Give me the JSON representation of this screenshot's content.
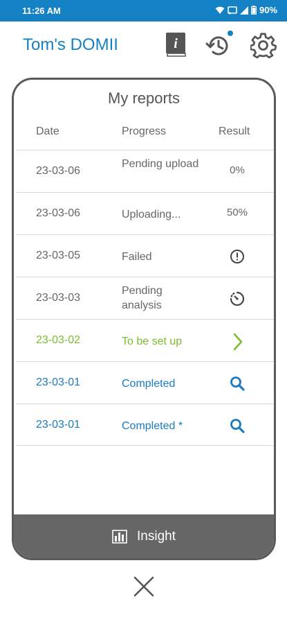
{
  "status_bar": {
    "time": "11:26 AM",
    "battery": "90%",
    "icons": [
      "wifi-icon",
      "cast-icon",
      "signal-icon",
      "battery-icon"
    ]
  },
  "header": {
    "title": "Tom's DOMII",
    "icons": [
      "info-book-icon",
      "history-icon",
      "settings-icon"
    ],
    "history_has_notification": true
  },
  "reports": {
    "title": "My reports",
    "columns": {
      "date": "Date",
      "progress": "Progress",
      "result": "Result"
    },
    "rows": [
      {
        "date": "23-03-06",
        "progress": "Pending upload",
        "result": "0%",
        "status": "pending"
      },
      {
        "date": "23-03-06",
        "progress": "Uploading...",
        "result": "50%",
        "status": "uploading"
      },
      {
        "date": "23-03-05",
        "progress": "Failed",
        "result_icon": "alert-circle-icon",
        "status": "failed"
      },
      {
        "date": "23-03-03",
        "progress": "Pending analysis",
        "result_icon": "timer-icon",
        "status": "analysis"
      },
      {
        "date": "23-03-02",
        "progress": "To be set up",
        "result_icon": "chevron-right-icon",
        "status": "setup"
      },
      {
        "date": "23-03-01",
        "progress": "Completed",
        "result_icon": "search-icon",
        "status": "completed"
      },
      {
        "date": "23-03-01",
        "progress": "Completed *",
        "result_icon": "search-icon",
        "status": "completed"
      }
    ]
  },
  "insight": {
    "label": "Insight",
    "icon": "bar-chart-icon"
  },
  "close": {
    "icon": "close-icon"
  },
  "colors": {
    "brand_blue": "#1581c5",
    "setup_green": "#7cbc2e",
    "completed_blue": "#1a7bc1",
    "text_grey": "#666666",
    "bar_grey": "#666666"
  }
}
